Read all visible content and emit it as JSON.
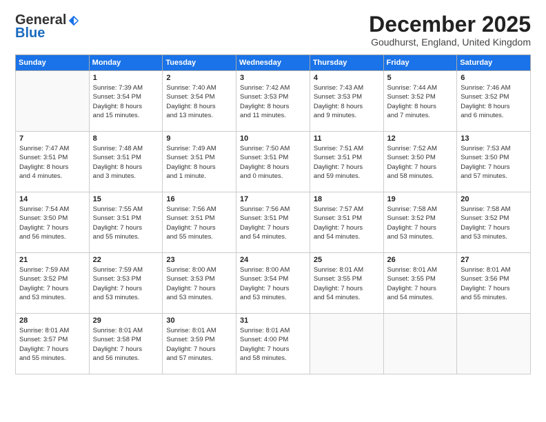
{
  "logo": {
    "general": "General",
    "blue": "Blue"
  },
  "header": {
    "month": "December 2025",
    "location": "Goudhurst, England, United Kingdom"
  },
  "days_of_week": [
    "Sunday",
    "Monday",
    "Tuesday",
    "Wednesday",
    "Thursday",
    "Friday",
    "Saturday"
  ],
  "weeks": [
    [
      {
        "day": "",
        "detail": ""
      },
      {
        "day": "1",
        "detail": "Sunrise: 7:39 AM\nSunset: 3:54 PM\nDaylight: 8 hours\nand 15 minutes."
      },
      {
        "day": "2",
        "detail": "Sunrise: 7:40 AM\nSunset: 3:54 PM\nDaylight: 8 hours\nand 13 minutes."
      },
      {
        "day": "3",
        "detail": "Sunrise: 7:42 AM\nSunset: 3:53 PM\nDaylight: 8 hours\nand 11 minutes."
      },
      {
        "day": "4",
        "detail": "Sunrise: 7:43 AM\nSunset: 3:53 PM\nDaylight: 8 hours\nand 9 minutes."
      },
      {
        "day": "5",
        "detail": "Sunrise: 7:44 AM\nSunset: 3:52 PM\nDaylight: 8 hours\nand 7 minutes."
      },
      {
        "day": "6",
        "detail": "Sunrise: 7:46 AM\nSunset: 3:52 PM\nDaylight: 8 hours\nand 6 minutes."
      }
    ],
    [
      {
        "day": "7",
        "detail": "Sunrise: 7:47 AM\nSunset: 3:51 PM\nDaylight: 8 hours\nand 4 minutes."
      },
      {
        "day": "8",
        "detail": "Sunrise: 7:48 AM\nSunset: 3:51 PM\nDaylight: 8 hours\nand 3 minutes."
      },
      {
        "day": "9",
        "detail": "Sunrise: 7:49 AM\nSunset: 3:51 PM\nDaylight: 8 hours\nand 1 minute."
      },
      {
        "day": "10",
        "detail": "Sunrise: 7:50 AM\nSunset: 3:51 PM\nDaylight: 8 hours\nand 0 minutes."
      },
      {
        "day": "11",
        "detail": "Sunrise: 7:51 AM\nSunset: 3:51 PM\nDaylight: 7 hours\nand 59 minutes."
      },
      {
        "day": "12",
        "detail": "Sunrise: 7:52 AM\nSunset: 3:50 PM\nDaylight: 7 hours\nand 58 minutes."
      },
      {
        "day": "13",
        "detail": "Sunrise: 7:53 AM\nSunset: 3:50 PM\nDaylight: 7 hours\nand 57 minutes."
      }
    ],
    [
      {
        "day": "14",
        "detail": "Sunrise: 7:54 AM\nSunset: 3:50 PM\nDaylight: 7 hours\nand 56 minutes."
      },
      {
        "day": "15",
        "detail": "Sunrise: 7:55 AM\nSunset: 3:51 PM\nDaylight: 7 hours\nand 55 minutes."
      },
      {
        "day": "16",
        "detail": "Sunrise: 7:56 AM\nSunset: 3:51 PM\nDaylight: 7 hours\nand 55 minutes."
      },
      {
        "day": "17",
        "detail": "Sunrise: 7:56 AM\nSunset: 3:51 PM\nDaylight: 7 hours\nand 54 minutes."
      },
      {
        "day": "18",
        "detail": "Sunrise: 7:57 AM\nSunset: 3:51 PM\nDaylight: 7 hours\nand 54 minutes."
      },
      {
        "day": "19",
        "detail": "Sunrise: 7:58 AM\nSunset: 3:52 PM\nDaylight: 7 hours\nand 53 minutes."
      },
      {
        "day": "20",
        "detail": "Sunrise: 7:58 AM\nSunset: 3:52 PM\nDaylight: 7 hours\nand 53 minutes."
      }
    ],
    [
      {
        "day": "21",
        "detail": "Sunrise: 7:59 AM\nSunset: 3:52 PM\nDaylight: 7 hours\nand 53 minutes."
      },
      {
        "day": "22",
        "detail": "Sunrise: 7:59 AM\nSunset: 3:53 PM\nDaylight: 7 hours\nand 53 minutes."
      },
      {
        "day": "23",
        "detail": "Sunrise: 8:00 AM\nSunset: 3:53 PM\nDaylight: 7 hours\nand 53 minutes."
      },
      {
        "day": "24",
        "detail": "Sunrise: 8:00 AM\nSunset: 3:54 PM\nDaylight: 7 hours\nand 53 minutes."
      },
      {
        "day": "25",
        "detail": "Sunrise: 8:01 AM\nSunset: 3:55 PM\nDaylight: 7 hours\nand 54 minutes."
      },
      {
        "day": "26",
        "detail": "Sunrise: 8:01 AM\nSunset: 3:55 PM\nDaylight: 7 hours\nand 54 minutes."
      },
      {
        "day": "27",
        "detail": "Sunrise: 8:01 AM\nSunset: 3:56 PM\nDaylight: 7 hours\nand 55 minutes."
      }
    ],
    [
      {
        "day": "28",
        "detail": "Sunrise: 8:01 AM\nSunset: 3:57 PM\nDaylight: 7 hours\nand 55 minutes."
      },
      {
        "day": "29",
        "detail": "Sunrise: 8:01 AM\nSunset: 3:58 PM\nDaylight: 7 hours\nand 56 minutes."
      },
      {
        "day": "30",
        "detail": "Sunrise: 8:01 AM\nSunset: 3:59 PM\nDaylight: 7 hours\nand 57 minutes."
      },
      {
        "day": "31",
        "detail": "Sunrise: 8:01 AM\nSunset: 4:00 PM\nDaylight: 7 hours\nand 58 minutes."
      },
      {
        "day": "",
        "detail": ""
      },
      {
        "day": "",
        "detail": ""
      },
      {
        "day": "",
        "detail": ""
      }
    ]
  ]
}
